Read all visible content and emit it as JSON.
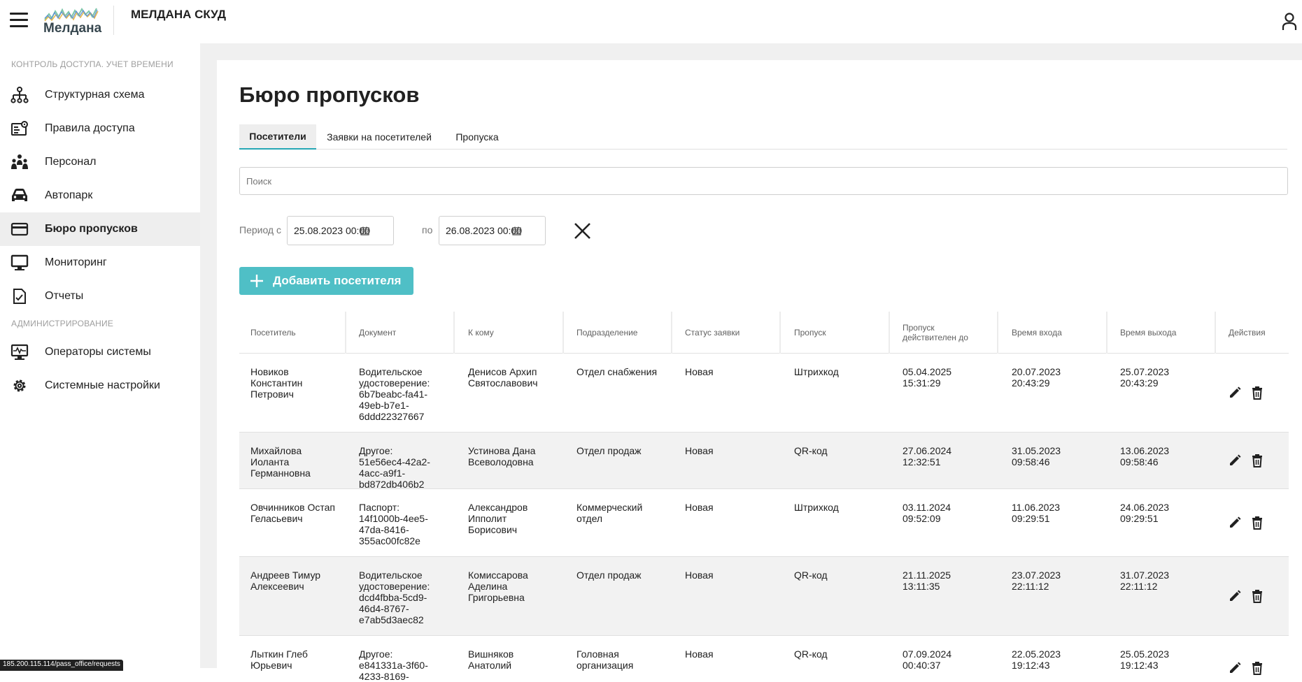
{
  "header": {
    "logo_text": "Мелдана",
    "app_title": "МЕЛДАНА СКУД"
  },
  "sidebar": {
    "section1": "КОНТРОЛЬ ДОСТУПА. УЧЕТ ВРЕМЕНИ",
    "section2": "АДМИНИСТРИРОВАНИЕ",
    "items": [
      {
        "label": "Структурная схема",
        "icon": "hierarchy-icon"
      },
      {
        "label": "Правила доступа",
        "icon": "access-rules-icon"
      },
      {
        "label": "Персонал",
        "icon": "people-icon"
      },
      {
        "label": "Автопарк",
        "icon": "car-icon"
      },
      {
        "label": "Бюро пропусков",
        "icon": "card-icon",
        "active": true
      },
      {
        "label": "Мониторинг",
        "icon": "monitor-icon"
      },
      {
        "label": "Отчеты",
        "icon": "report-icon"
      },
      {
        "label": "Операторы системы",
        "icon": "operators-icon"
      },
      {
        "label": "Системные настройки",
        "icon": "gear-icon"
      }
    ]
  },
  "page": {
    "title": "Бюро пропусков",
    "tabs": [
      "Посетители",
      "Заявки на посетителей",
      "Пропуска"
    ],
    "search_placeholder": "Поиск",
    "period_from_label": "Период с",
    "period_from": "25.08.2023 00:00",
    "period_to_label": "по",
    "period_to": "26.08.2023 00:00",
    "add_button": "Добавить посетителя"
  },
  "table": {
    "columns": [
      "Посетитель",
      "Документ",
      "К кому",
      "Подразделение",
      "Статус заявки",
      "Пропуск",
      "Пропуск действителен до",
      "Время входа",
      "Время выхода",
      "Действия"
    ],
    "rows": [
      [
        "Новиков Константин Петрович",
        "Водительское удостоверение: 6b7beabc-fa41-49eb-b7e1-6ddd22327667",
        "Денисов Архип Святославович",
        "Отдел снабжения",
        "Новая",
        "Штрихкод",
        "05.04.2025 15:31:29",
        "20.07.2023 20:43:29",
        "25.07.2023 20:43:29"
      ],
      [
        "Михайлова Иоланта Германновна",
        "Другое: 51e56ec4-42a2-4acc-a9f1-bd872db406b2",
        "Устинова Дана Всеволодовна",
        "Отдел продаж",
        "Новая",
        "QR-код",
        "27.06.2024 12:32:51",
        "31.05.2023 09:58:46",
        "13.06.2023 09:58:46"
      ],
      [
        "Овчинников Остап Геласьевич",
        "Паспорт: 14f1000b-4ee5-47da-8416-355ac00fc82e",
        "Александров Ипполит Борисович",
        "Коммерческий отдел",
        "Новая",
        "Штрихкод",
        "03.11.2024 09:52:09",
        "11.06.2023 09:29:51",
        "24.06.2023 09:29:51"
      ],
      [
        "Андреев Тимур Алексеевич",
        "Водительское удостоверение: dcd4fbba-5cd9-46d4-8767-e7ab5d3aec82",
        "Комиссарова Аделина Григорьевна",
        "Отдел продаж",
        "Новая",
        "QR-код",
        "21.11.2025 13:11:35",
        "23.07.2023 22:11:12",
        "31.07.2023 22:11:12"
      ],
      [
        "Лыткин Глеб Юрьевич",
        "Другое: e841331a-3f60-4233-8169-",
        "Вишняков Анатолий",
        "Головная организация",
        "Новая",
        "QR-код",
        "07.09.2024 00:40:37",
        "22.05.2023 19:12:43",
        "25.05.2023 19:12:43"
      ]
    ]
  },
  "statusbar": {
    "url": "185.200.115.114/pass_office/requests"
  },
  "colors": {
    "accent": "#4fbfc6",
    "tab_underline": "#26a7b5"
  }
}
